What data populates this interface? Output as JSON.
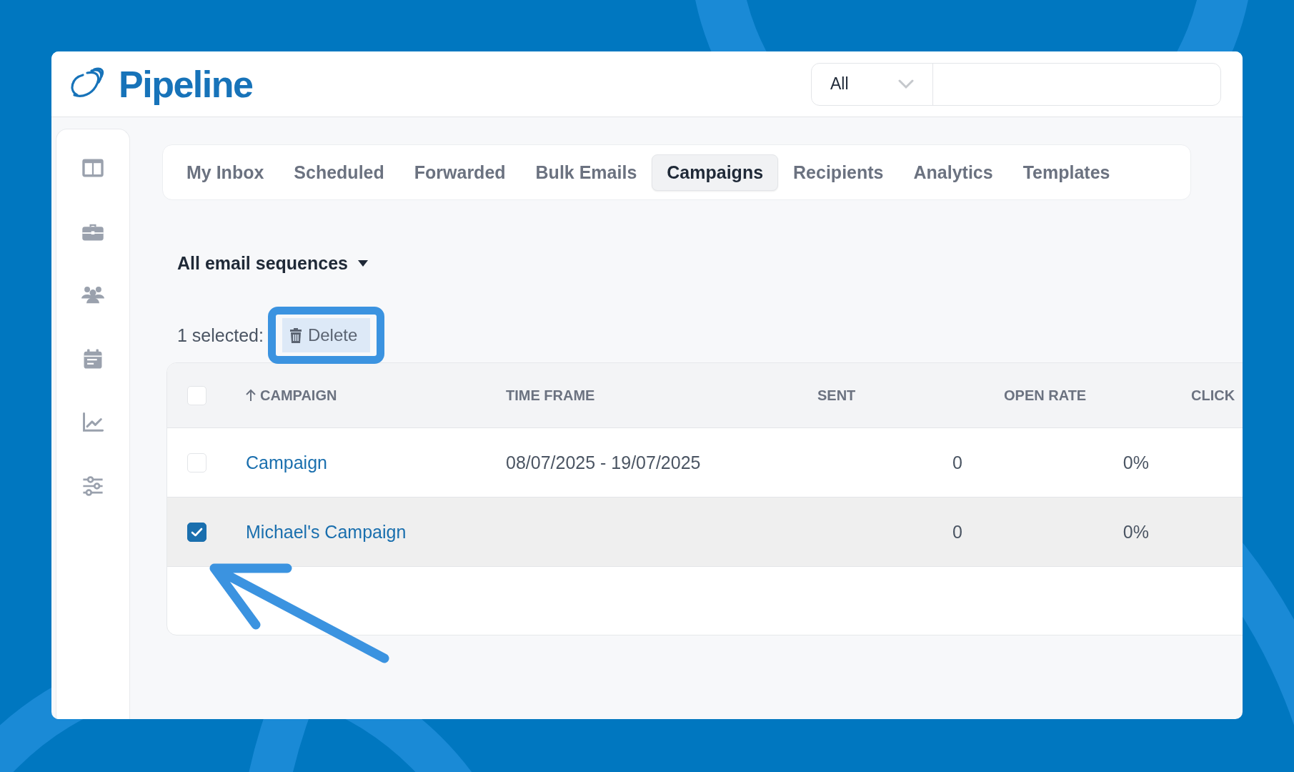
{
  "header": {
    "logo_text": "Pipeline",
    "search_scope": "All"
  },
  "tabs": [
    {
      "label": "My Inbox",
      "selected": false
    },
    {
      "label": "Scheduled",
      "selected": false
    },
    {
      "label": "Forwarded",
      "selected": false
    },
    {
      "label": "Bulk Emails",
      "selected": false
    },
    {
      "label": "Campaigns",
      "selected": true
    },
    {
      "label": "Recipients",
      "selected": false
    },
    {
      "label": "Analytics",
      "selected": false
    },
    {
      "label": "Templates",
      "selected": false
    }
  ],
  "filter": {
    "label": "All email sequences"
  },
  "bulk_actions": {
    "selected_count": "1 selected:",
    "delete_label": "Delete"
  },
  "table": {
    "select_all": {
      "checked": false
    },
    "columns": [
      {
        "label": "CAMPAIGN",
        "sorted": true
      },
      {
        "label": "TIME FRAME",
        "sorted": false
      },
      {
        "label": "SENT",
        "sorted": false
      },
      {
        "label": "OPEN RATE",
        "sorted": false
      },
      {
        "label": "CLICK",
        "sorted": false
      }
    ],
    "rows": [
      {
        "checked": false,
        "campaign": "Campaign",
        "time_frame": "08/07/2025 - 19/07/2025",
        "sent": "0",
        "open_rate": "0%"
      },
      {
        "checked": true,
        "campaign": "Michael's Campaign",
        "sent": "0",
        "open_rate": "0%"
      }
    ]
  }
}
